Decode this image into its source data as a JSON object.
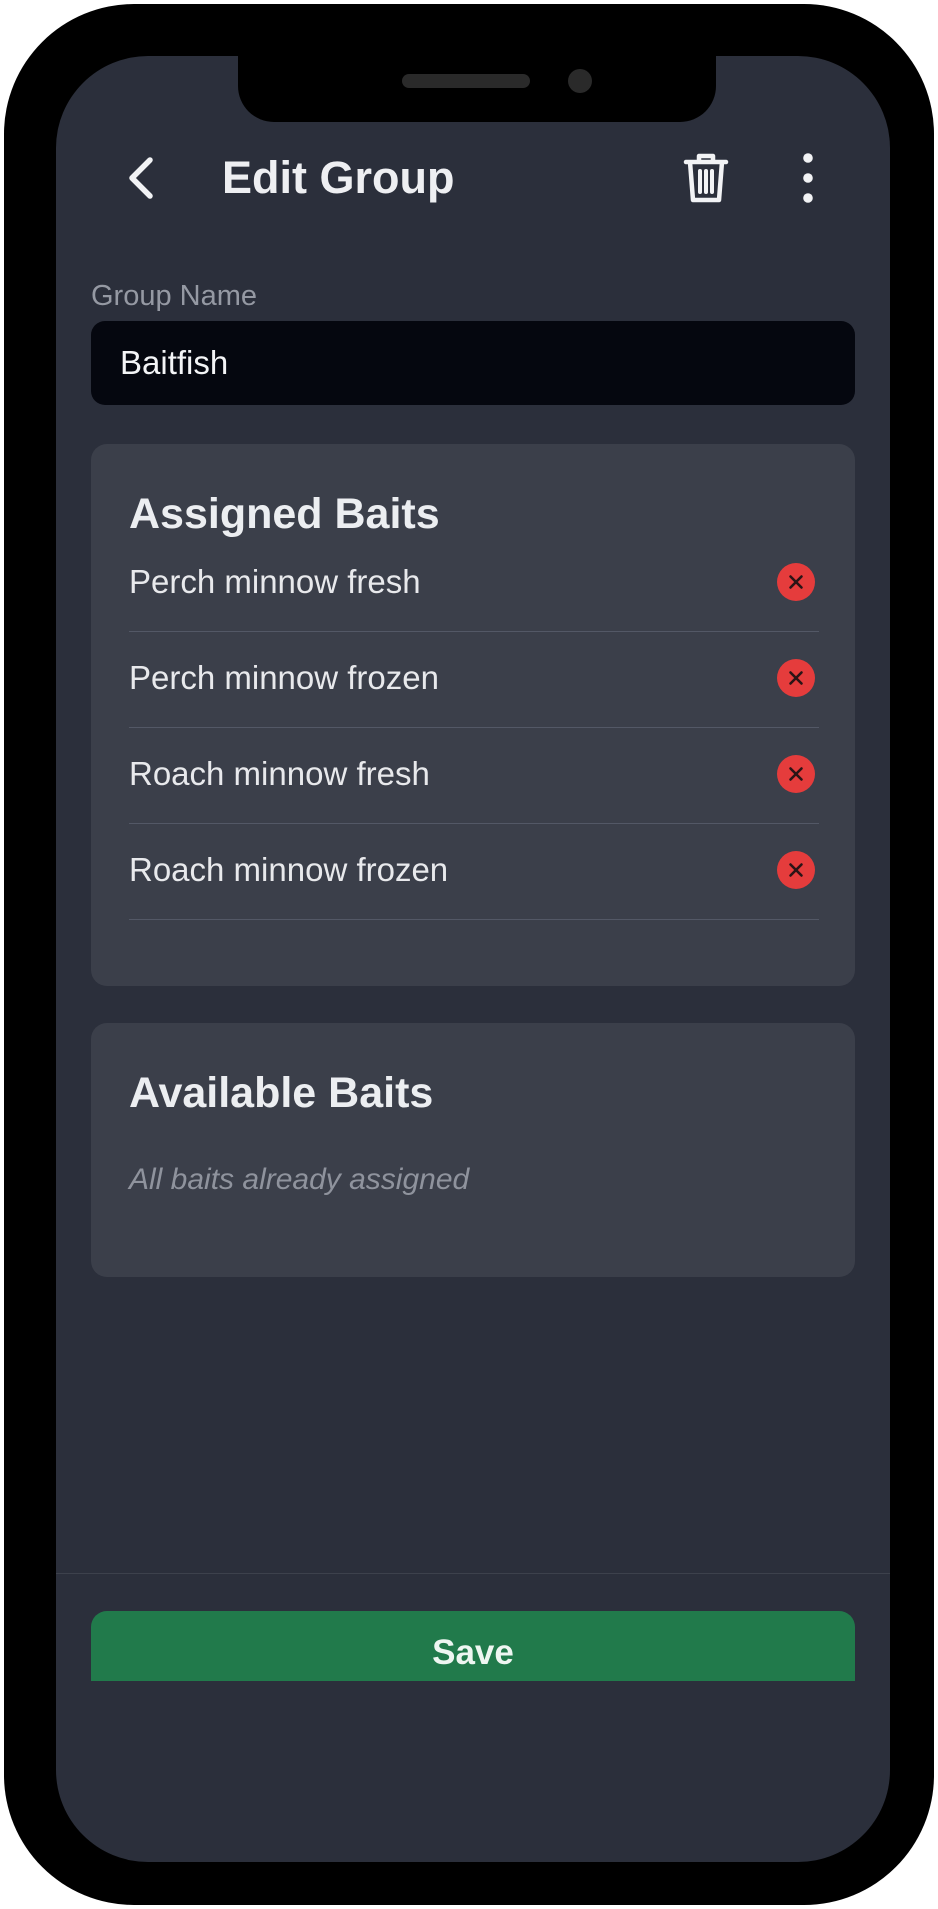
{
  "header": {
    "title": "Edit Group",
    "back_icon": "chevron-left-icon",
    "delete_icon": "trash-icon",
    "menu_icon": "more-vertical-icon"
  },
  "group_name": {
    "label": "Group Name",
    "value": "Baitfish"
  },
  "assigned": {
    "title": "Assigned Baits",
    "remove_icon": "close-circle-icon",
    "items": [
      {
        "label": "Perch minnow fresh"
      },
      {
        "label": "Perch minnow frozen"
      },
      {
        "label": "Roach minnow fresh"
      },
      {
        "label": "Roach minnow frozen"
      }
    ]
  },
  "available": {
    "title": "Available Baits",
    "empty_text": "All baits already assigned"
  },
  "footer": {
    "save_label": "Save"
  },
  "colors": {
    "background": "#2b2f3b",
    "card": "#3b3f4a",
    "input": "#05070f",
    "remove": "#e53c3c",
    "save": "#217a4b"
  }
}
